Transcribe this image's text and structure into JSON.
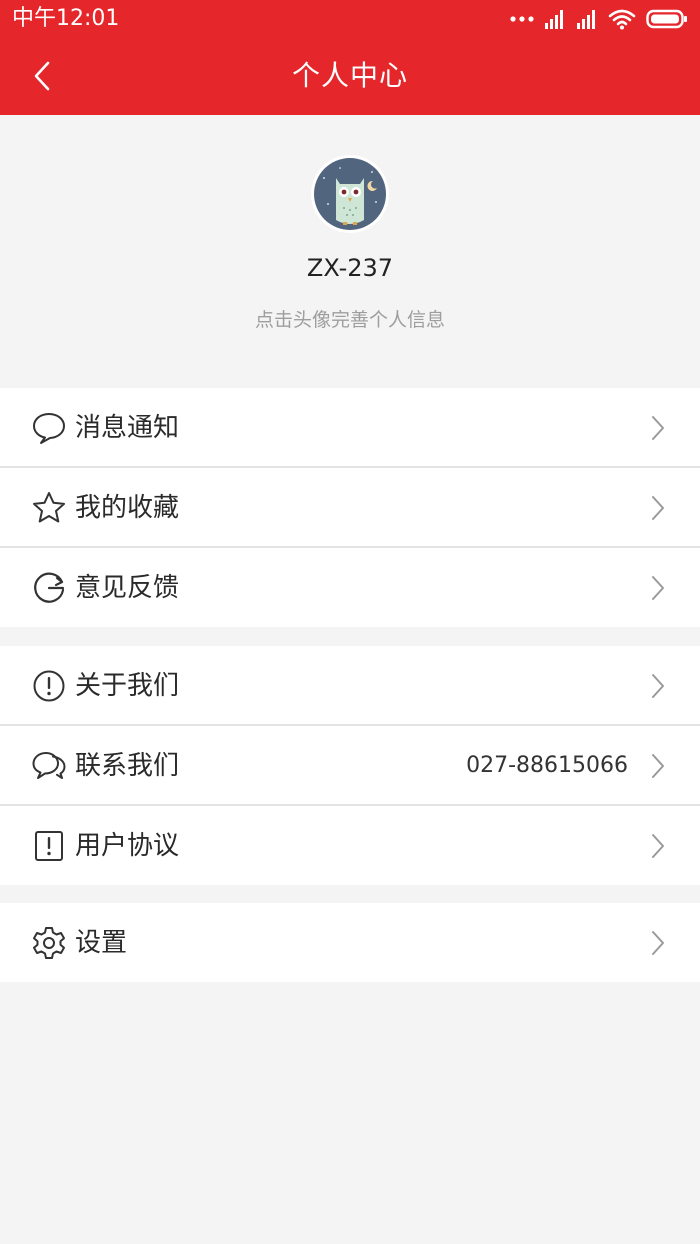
{
  "status_bar": {
    "time": "中午12:01"
  },
  "nav": {
    "title": "个人中心"
  },
  "profile": {
    "username": "ZX-237",
    "hint": "点击头像完善个人信息"
  },
  "group1": [
    {
      "label": "消息通知",
      "icon": "chat-bubble-icon"
    },
    {
      "label": "我的收藏",
      "icon": "star-icon"
    },
    {
      "label": "意见反馈",
      "icon": "feedback-icon"
    }
  ],
  "group2": [
    {
      "label": "关于我们",
      "icon": "info-circle-icon"
    },
    {
      "label": "联系我们",
      "icon": "chat-bubbles-icon",
      "value": "027-88615066"
    },
    {
      "label": "用户协议",
      "icon": "notice-icon"
    }
  ],
  "group3": [
    {
      "label": "设置",
      "icon": "gear-icon"
    }
  ],
  "colors": {
    "brand": "#e5262a",
    "background": "#f4f4f4",
    "hint": "#9e9e9e"
  }
}
